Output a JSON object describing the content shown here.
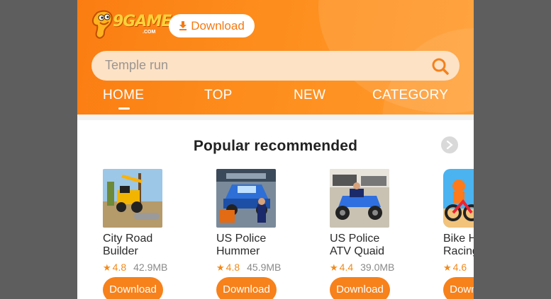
{
  "header": {
    "logo_text": "9GAME",
    "logo_sub": ".COM",
    "download_label": "Download",
    "search_placeholder": "Temple run"
  },
  "tabs": [
    {
      "label": "HOME",
      "active": true
    },
    {
      "label": "TOP",
      "active": false
    },
    {
      "label": "NEW",
      "active": false
    },
    {
      "label": "CATEGORY",
      "active": false
    }
  ],
  "section": {
    "title": "Popular recommended"
  },
  "games": [
    {
      "name": "City Road\nBuilder",
      "rating": "4.8",
      "size": "42.9MB",
      "button": "Download"
    },
    {
      "name": "US Police\nHummer",
      "rating": "4.8",
      "size": "45.9MB",
      "button": "Download"
    },
    {
      "name": "US Police\nATV Quaid",
      "rating": "4.4",
      "size": "39.0MB",
      "button": "Download"
    },
    {
      "name": "Bike Hill\nRacing",
      "rating": "4.6",
      "size": "",
      "button": "Download"
    }
  ],
  "colors": {
    "brand_orange": "#f7811b",
    "header_gradient_start": "#fb7d12",
    "rating_color": "#f28a1a"
  }
}
